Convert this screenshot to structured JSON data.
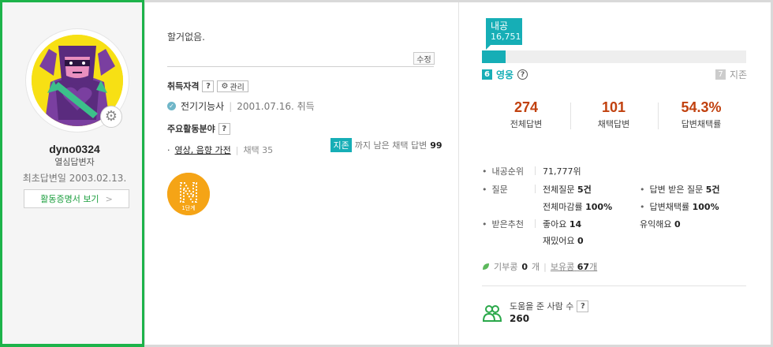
{
  "profile": {
    "username": "dyno0324",
    "rank_title": "열심답변자",
    "first_answer": "최초답변일 2003.02.13.",
    "cert_button": "활동증명서 보기",
    "avatar_icon": "superhero-avatar",
    "settings_icon": "gear-icon"
  },
  "intro": {
    "text": "할거없음.",
    "edit_label": "수정"
  },
  "qualification": {
    "title": "취득자격",
    "help": "?",
    "manage_label": "관리",
    "cert_name": "전기기능사",
    "cert_date": "2001.07.16. 취득"
  },
  "activity": {
    "title": "주요활동분야",
    "help": "?",
    "area": "영상, 음향 가전",
    "adopted": "채택 35"
  },
  "badge": {
    "letter": "N",
    "label": "1단계"
  },
  "grade": {
    "name": "내공",
    "points": "16,751",
    "progress": 0.09,
    "current_level_num": "6",
    "current_level": "영웅",
    "level_help": "?",
    "next_level_num": "7",
    "next_level": "지존",
    "colors": {
      "accent": "#16aeb6",
      "stat": "#c1410f"
    }
  },
  "stats": [
    {
      "value": "274",
      "label": "전체답변"
    },
    {
      "value": "101",
      "label": "채택답변"
    },
    {
      "value": "54.3%",
      "label": "답변채택률"
    }
  ],
  "next_goal": {
    "tag": "지존",
    "text": "까지 남은 채택 답변",
    "value": "99"
  },
  "details": {
    "rank_label": "내공순위",
    "rank_value": "71,777위",
    "question_label": "질문",
    "total_questions": "전체질문",
    "total_questions_val": "5건",
    "closed_rate": "전체마감률",
    "closed_rate_val": "100%",
    "received_answers": "답변 받은 질문",
    "received_answers_val": "5건",
    "adopt_rate": "답변채택률",
    "adopt_rate_val": "100%",
    "votes_label": "받은추천",
    "like": "좋아요",
    "like_val": "14",
    "useful": "유익해요",
    "useful_val": "0",
    "fun": "재밌어요",
    "fun_val": "0"
  },
  "coins": {
    "donate_label": "기부콩",
    "donate_val": "0",
    "donate_unit": "개",
    "held_label": "보유콩",
    "held_val": "67",
    "held_unit": "개"
  },
  "helped": {
    "label": "도움을 준 사람 수",
    "help": "?",
    "value": "260"
  }
}
